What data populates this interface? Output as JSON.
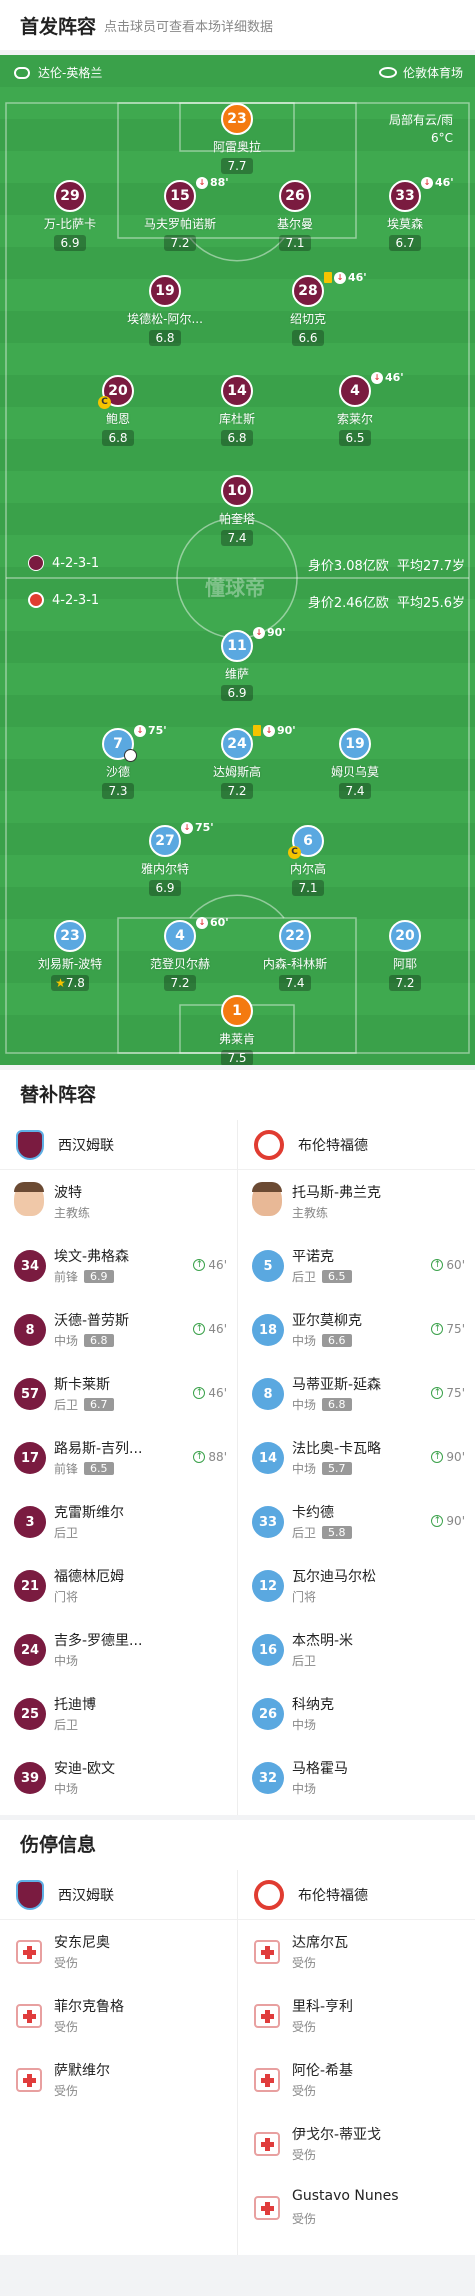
{
  "header": {
    "title": "首发阵容",
    "subtitle": "点击球员可查看本场详细数据"
  },
  "match": {
    "referee": "达伦-英格兰",
    "stadium": "伦敦体育场",
    "weather_line1": "局部有云/雨",
    "weather_line2": "6°C",
    "watermark": "懂球帝"
  },
  "home": {
    "name": "西汉姆联",
    "formation": "4-2-3-1",
    "value": "身价3.08亿欧",
    "age": "平均27.7岁",
    "players": [
      {
        "num": "23",
        "name": "阿雷奥拉",
        "rating": "7.7",
        "gk": true
      },
      {
        "num": "29",
        "name": "万-比萨卡",
        "rating": "6.9"
      },
      {
        "num": "15",
        "name": "马夫罗帕诺斯",
        "rating": "7.2",
        "sub": "88'"
      },
      {
        "num": "26",
        "name": "基尔曼",
        "rating": "7.1"
      },
      {
        "num": "33",
        "name": "埃莫森",
        "rating": "6.7",
        "sub": "46'"
      },
      {
        "num": "19",
        "name": "埃德松-阿尔...",
        "rating": "6.8"
      },
      {
        "num": "28",
        "name": "绍切克",
        "rating": "6.6",
        "sub": "46'"
      },
      {
        "num": "20",
        "name": "鲍恩",
        "rating": "6.8"
      },
      {
        "num": "14",
        "name": "库杜斯",
        "rating": "6.8"
      },
      {
        "num": "4",
        "name": "索莱尔",
        "rating": "6.5",
        "sub": "46'"
      },
      {
        "num": "10",
        "name": "帕奎塔",
        "rating": "7.4"
      }
    ]
  },
  "away": {
    "name": "布伦特福德",
    "formation": "4-2-3-1",
    "value": "身价2.46亿欧",
    "age": "平均25.6岁",
    "players": [
      {
        "num": "11",
        "name": "维萨",
        "rating": "6.9",
        "sub": "90'"
      },
      {
        "num": "7",
        "name": "沙德",
        "rating": "7.3",
        "sub": "75'"
      },
      {
        "num": "24",
        "name": "达姆斯高",
        "rating": "7.2",
        "sub": "90'"
      },
      {
        "num": "19",
        "name": "姆贝乌莫",
        "rating": "7.4"
      },
      {
        "num": "27",
        "name": "雅内尔特",
        "rating": "6.9",
        "sub": "75'"
      },
      {
        "num": "6",
        "name": "内尔高",
        "rating": "7.1"
      },
      {
        "num": "23",
        "name": "刘易斯-波特",
        "rating": "7.8"
      },
      {
        "num": "4",
        "name": "范登贝尔赫",
        "rating": "7.2",
        "sub": "60'"
      },
      {
        "num": "22",
        "name": "内森-科林斯",
        "rating": "7.4"
      },
      {
        "num": "20",
        "name": "阿耶",
        "rating": "7.2"
      },
      {
        "num": "1",
        "name": "弗莱肯",
        "rating": "7.5",
        "gk": true
      }
    ]
  },
  "subs": {
    "title": "替补阵容",
    "home": {
      "team": "西汉姆联",
      "coach": {
        "name": "波特",
        "role": "主教练"
      },
      "list": [
        {
          "num": "34",
          "name": "埃文-弗格森",
          "pos": "前锋",
          "rating": "6.9",
          "time": "46'"
        },
        {
          "num": "8",
          "name": "沃德-普劳斯",
          "pos": "中场",
          "rating": "6.8",
          "time": "46'"
        },
        {
          "num": "57",
          "name": "斯卡莱斯",
          "pos": "后卫",
          "rating": "6.7",
          "time": "46'"
        },
        {
          "num": "17",
          "name": "路易斯-吉列...",
          "pos": "前锋",
          "rating": "6.5",
          "time": "88'"
        },
        {
          "num": "3",
          "name": "克雷斯维尔",
          "pos": "后卫"
        },
        {
          "num": "21",
          "name": "福德林厄姆",
          "pos": "门将"
        },
        {
          "num": "24",
          "name": "吉多-罗德里...",
          "pos": "中场"
        },
        {
          "num": "25",
          "name": "托迪博",
          "pos": "后卫"
        },
        {
          "num": "39",
          "name": "安迪-欧文",
          "pos": "中场"
        }
      ]
    },
    "away": {
      "team": "布伦特福德",
      "coach": {
        "name": "托马斯-弗兰克",
        "role": "主教练"
      },
      "list": [
        {
          "num": "5",
          "name": "平诺克",
          "pos": "后卫",
          "rating": "6.5",
          "time": "60'"
        },
        {
          "num": "18",
          "name": "亚尔莫柳克",
          "pos": "中场",
          "rating": "6.6",
          "time": "75'"
        },
        {
          "num": "8",
          "name": "马蒂亚斯-延森",
          "pos": "中场",
          "rating": "6.8",
          "time": "75'"
        },
        {
          "num": "14",
          "name": "法比奥-卡瓦略",
          "pos": "中场",
          "rating": "5.7",
          "time": "90'"
        },
        {
          "num": "33",
          "name": "卡约德",
          "pos": "后卫",
          "rating": "5.8",
          "time": "90'"
        },
        {
          "num": "12",
          "name": "瓦尔迪马尔松",
          "pos": "门将"
        },
        {
          "num": "16",
          "name": "本杰明-米",
          "pos": "后卫"
        },
        {
          "num": "26",
          "name": "科纳克",
          "pos": "中场"
        },
        {
          "num": "32",
          "name": "马格霍马",
          "pos": "中场"
        }
      ]
    }
  },
  "injuries": {
    "title": "伤停信息",
    "home": {
      "team": "西汉姆联",
      "list": [
        {
          "name": "安东尼奥",
          "status": "受伤"
        },
        {
          "name": "菲尔克鲁格",
          "status": "受伤"
        },
        {
          "name": "萨默维尔",
          "status": "受伤"
        }
      ]
    },
    "away": {
      "team": "布伦特福德",
      "list": [
        {
          "name": "达席尔瓦",
          "status": "受伤"
        },
        {
          "name": "里科-亨利",
          "status": "受伤"
        },
        {
          "name": "阿伦-希基",
          "status": "受伤"
        },
        {
          "name": "伊戈尔-蒂亚戈",
          "status": "受伤"
        },
        {
          "name": "Gustavo Nunes",
          "status": "受伤"
        }
      ]
    }
  }
}
